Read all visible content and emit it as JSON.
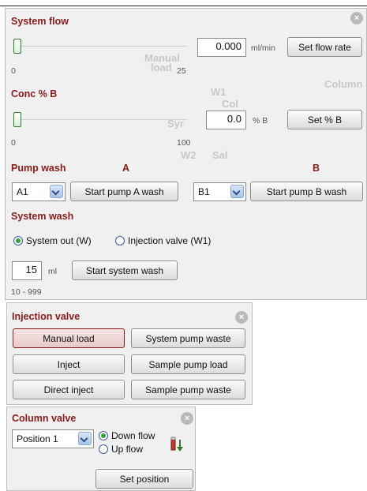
{
  "ghost_text": [
    "Manual",
    "load",
    "W1",
    "Col",
    "Syr",
    "W2",
    "Sal",
    "Column"
  ],
  "system_flow": {
    "title": "System flow",
    "value": "0.000",
    "unit": "ml/min",
    "button": "Set flow rate",
    "min": "0",
    "max": "25",
    "level": 0
  },
  "conc_b": {
    "title": "Conc % B",
    "value": "0.0",
    "unit": "% B",
    "button": "Set % B",
    "min": "0",
    "max": "100",
    "level": 0
  },
  "pump_wash": {
    "title": "Pump wash",
    "col_a": "A",
    "col_b": "B",
    "select_a": "A1",
    "select_b": "B1",
    "button_a": "Start pump A wash",
    "button_b": "Start pump B wash"
  },
  "system_wash": {
    "title": "System wash",
    "radio_1": "System out (W)",
    "radio_2": "Injection valve (W1)",
    "selected": "System out (W)",
    "volume": "15",
    "unit": "ml",
    "button": "Start system wash",
    "range": "10 - 999"
  },
  "injection_valve": {
    "title": "Injection valve",
    "buttons": [
      "Manual load",
      "System pump waste",
      "Inject",
      "Sample pump load",
      "Direct inject",
      "Sample pump waste"
    ],
    "active": "Manual load"
  },
  "column_valve": {
    "title": "Column valve",
    "position": "Position 1",
    "radio_1": "Down flow",
    "radio_2": "Up flow",
    "selected": "Down flow",
    "button": "Set position"
  },
  "colors": {
    "accent": "#8b1a1a",
    "radio_on": "#2fa52f"
  },
  "icons": [
    "close-icon",
    "chevron-down-icon",
    "flow-direction-icon"
  ]
}
